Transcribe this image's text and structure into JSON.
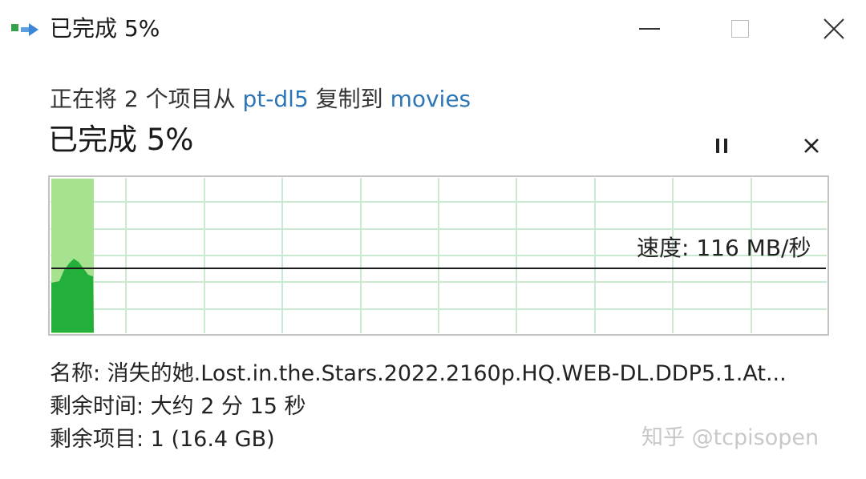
{
  "window": {
    "title": "已完成 5%",
    "minimize_icon": "minimize-icon",
    "maximize_icon": "maximize-icon",
    "close_icon": "close-icon"
  },
  "operation": {
    "prefix": "正在将 2 个项目从 ",
    "source": "pt-dl5",
    "middle": " 复制到 ",
    "destination": "movies",
    "link_color": "#2d75b5"
  },
  "progress": {
    "label": "已完成 5%",
    "percent": 5,
    "pause_icon": "pause-icon",
    "cancel_icon": "cancel-icon"
  },
  "speed_graph": {
    "speed_text": "速度: 116 MB/秒",
    "fill_color": "#22b03a",
    "completed_fill_color": "#a6e28f",
    "grid_color": "#c9ead0"
  },
  "details": {
    "name_line": "名称: 消失的她.Lost.in.the.Stars.2022.2160p.HQ.WEB-DL.DDP5.1.At...",
    "time_line": "剩余时间: 大约 2 分 15 秒",
    "items_line": "剩余项目: 1 (16.4 GB)"
  },
  "watermark": "知乎 @tcpisopen"
}
